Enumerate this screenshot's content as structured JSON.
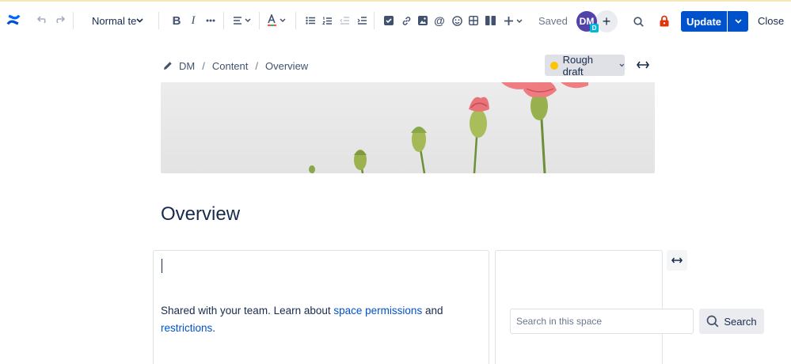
{
  "toolbar": {
    "text_style": "Normal text",
    "saved_label": "Saved",
    "avatar_initials": "DM",
    "avatar_badge": "D",
    "invite_label": "+",
    "update_label": "Update",
    "close_label": "Close",
    "icons": [
      "confluence-logo-icon",
      "undo-icon",
      "redo-icon",
      "bold-icon",
      "italic-icon",
      "more-formatting-icon",
      "align-icon",
      "text-color-icon",
      "bullet-list-icon",
      "numbered-list-icon",
      "outdent-icon",
      "indent-icon",
      "task-icon",
      "link-icon",
      "image-icon",
      "mention-icon",
      "emoji-icon",
      "table-icon",
      "layouts-icon",
      "insert-icon",
      "search-icon",
      "restrictions-lock-icon"
    ]
  },
  "breadcrumb": {
    "items": [
      "DM",
      "Content",
      "Overview"
    ]
  },
  "status": {
    "label": "Rough draft",
    "color": "#ffc400"
  },
  "page": {
    "title": "Overview"
  },
  "content": {
    "share_text_1": "Shared with your team. Learn about ",
    "space_permissions_link": "space permissions",
    "share_text_2": " and ",
    "restrictions_link": "restrictions",
    "share_text_3": "."
  },
  "search": {
    "placeholder": "Search in this space",
    "button_label": "Search"
  },
  "colors": {
    "primary": "#0052cc",
    "text": "#172b4d",
    "lock": "#de350b",
    "logo": "#0052cc"
  }
}
